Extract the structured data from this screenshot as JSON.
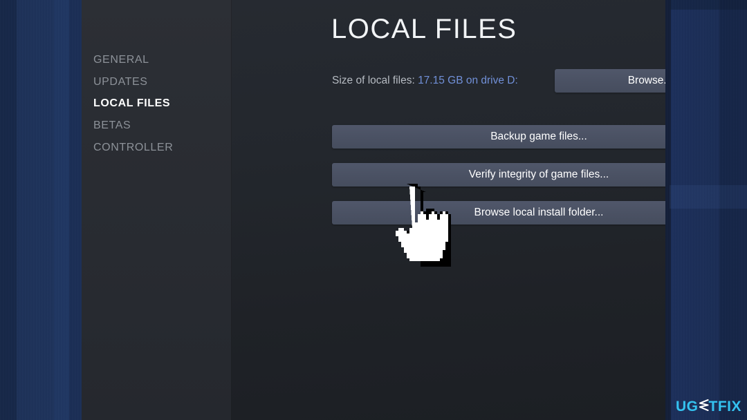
{
  "window": {
    "title": "LOCAL FILES"
  },
  "sidebar": {
    "items": [
      {
        "label": "GENERAL",
        "active": false
      },
      {
        "label": "UPDATES",
        "active": false
      },
      {
        "label": "LOCAL FILES",
        "active": true
      },
      {
        "label": "BETAS",
        "active": false
      },
      {
        "label": "CONTROLLER",
        "active": false
      }
    ]
  },
  "main": {
    "size_label": "Size of local files:",
    "size_value": "17.15 GB on drive D:",
    "browse_button": "Browse...",
    "buttons": [
      {
        "label": "Backup game files..."
      },
      {
        "label": "Verify integrity of game files..."
      },
      {
        "label": "Browse local install folder..."
      }
    ]
  },
  "cursor": {
    "icon": "pointing-hand-cursor"
  },
  "watermark": {
    "part1": "UG",
    "part2": "E",
    "part3": "TFIX",
    "accent_color": "#34c2f0"
  },
  "colors": {
    "backdrop_blue": "#1d3157",
    "window_bg": "#1f2329",
    "sidebar_bg": "#2a2d33",
    "button_bg": "#4a5163",
    "link_blue": "#7190d8",
    "active_text": "#ffffff",
    "muted_text": "#8d9299"
  }
}
